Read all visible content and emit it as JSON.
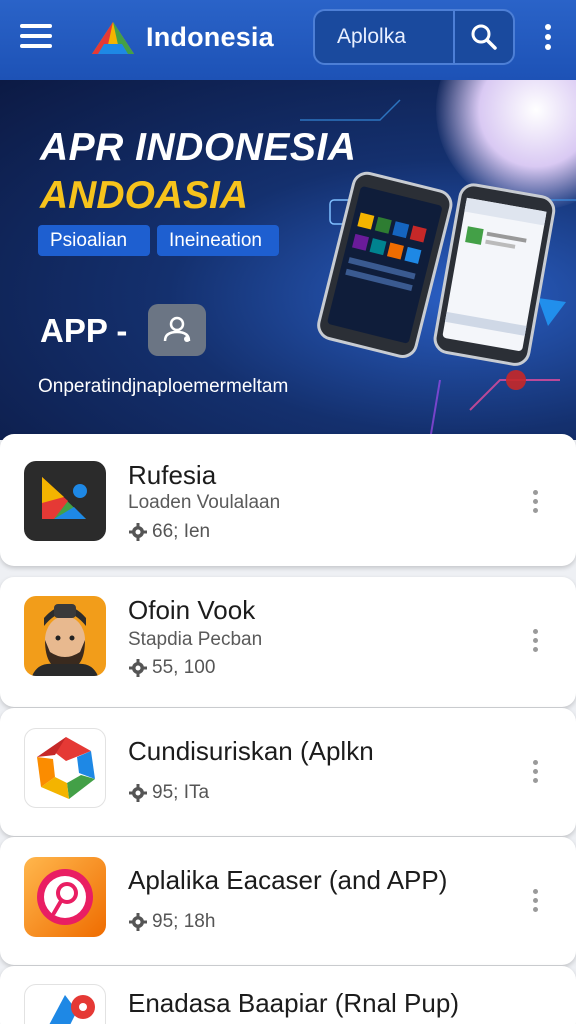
{
  "header": {
    "brand": "Indonesia",
    "search_value": "Aplolka",
    "icons": {
      "menu": "hamburger-icon",
      "logo": "triangle-logo",
      "search": "search-icon",
      "more": "more-vert-icon"
    }
  },
  "hero": {
    "title": "APR INDONESIA",
    "subtitle": "ANDOASIA",
    "chips": [
      "Psioalian",
      "Ineineation"
    ],
    "app_label": "APP -",
    "description": "Onperatindjnaploemermeltam"
  },
  "apps": [
    {
      "title": "Rufesia",
      "subtitle": "Loaden Voulalaan",
      "meta": "66; Ien"
    },
    {
      "title": "Ofoin Vook",
      "subtitle": "Stapdia Pecban",
      "meta": "55, 100"
    },
    {
      "title": "Cundisuriskan (Aplkn",
      "subtitle": "",
      "meta": "95; ITa"
    },
    {
      "title": "Aplalika Eacaser (and APP)",
      "subtitle": "",
      "meta": "95; 18h"
    },
    {
      "title": "Enadasa Baapiar (Rnal Pup)",
      "subtitle": "",
      "meta": ""
    }
  ],
  "colors": {
    "appbar": "#1d52b6",
    "accent_yellow": "#f6c31c",
    "chip": "#1e5fd0"
  }
}
